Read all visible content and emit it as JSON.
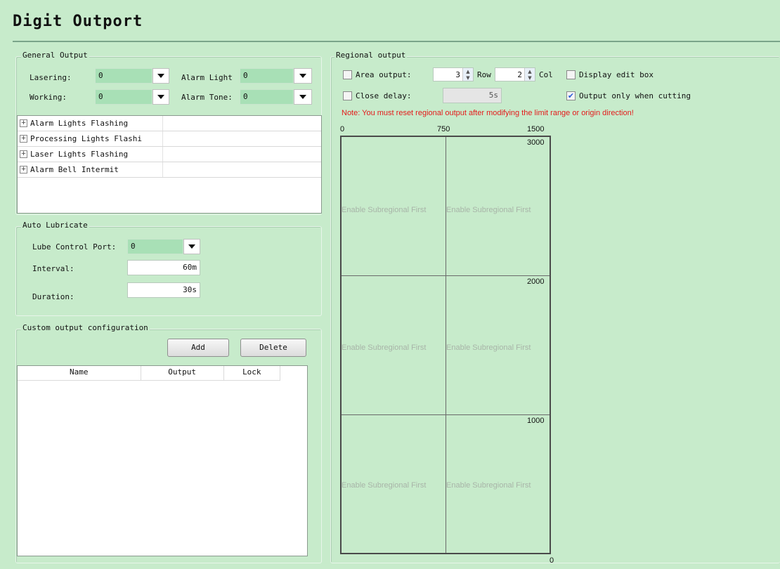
{
  "page": {
    "title": "Digit Outport"
  },
  "general_output": {
    "legend": "General Output",
    "lasering": {
      "label": "Lasering:",
      "value": "0"
    },
    "working": {
      "label": "Working:",
      "value": "0"
    },
    "alarm_light": {
      "label": "Alarm Light",
      "value": "0"
    },
    "alarm_tone": {
      "label": "Alarm Tone:",
      "value": "0"
    },
    "tree_items": [
      "Alarm Lights Flashing",
      "Processing Lights Flashi",
      "Laser Lights Flashing",
      "Alarm Bell Intermit"
    ]
  },
  "auto_lubricate": {
    "legend": "Auto Lubricate",
    "port": {
      "label": "Lube Control Port:",
      "value": "0"
    },
    "interval": {
      "label": "Interval:",
      "value": "60m"
    },
    "duration": {
      "label": "Duration:",
      "value": "30s"
    }
  },
  "custom_output": {
    "legend": "Custom output configuration",
    "add_label": "Add",
    "delete_label": "Delete",
    "columns": [
      "Name",
      "Output",
      "Lock"
    ]
  },
  "regional_output": {
    "legend": "Regional output",
    "area_output": {
      "label": "Area output:",
      "checked": false
    },
    "row": {
      "value": "3",
      "label": "Row"
    },
    "col": {
      "value": "2",
      "label": "Col"
    },
    "display_edit_box": {
      "label": "Display edit box",
      "checked": false
    },
    "close_delay": {
      "label": "Close delay:",
      "checked": false,
      "value": "5s"
    },
    "output_only_cutting": {
      "label": "Output only when cutting",
      "checked": true
    },
    "note": "Note: You must reset regional output after modifying the limit range or origin direction!",
    "x_ticks": [
      "0",
      "750",
      "1500"
    ],
    "y_ticks": [
      "3000",
      "2000",
      "1000",
      "0"
    ],
    "cell_text": "Enable Subregional First"
  },
  "icons": {
    "dropdown": "chevron-down-icon",
    "spin_up": "spin-up-icon",
    "spin_down": "spin-down-icon",
    "expand": "plus-expand-icon",
    "check": "checkmark-icon"
  },
  "colors": {
    "background": "#c7ebcb",
    "combo_fill": "#a8e0b6",
    "note_red": "#e41b1b",
    "check_blue": "#2a5bd7"
  }
}
